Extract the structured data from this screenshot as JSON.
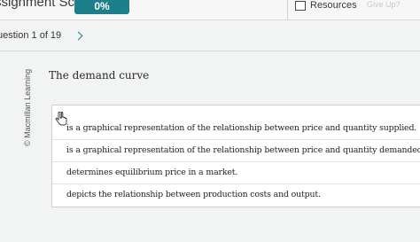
{
  "header": {
    "score_label": "ssignment Score:",
    "score_value": "0%",
    "resources_label": "Resources",
    "give_up_label": "Give Up?"
  },
  "question_nav": {
    "label": "uestion 1 of 19"
  },
  "copyright": "© Macmillan Learning",
  "question": {
    "prompt": "The demand curve",
    "options": [
      "is a graphical representation of the relationship between price and quantity supplied.",
      "is a graphical representation of the relationship between price and quantity demanded.",
      "determines equilibrium price in a market.",
      "depicts the relationship between production costs and output."
    ]
  },
  "colors": {
    "accent": "#1d7f8c",
    "background": "#f2f3f3"
  },
  "icons": [
    "checkbox-icon",
    "chevron-right-icon",
    "hand-cursor-icon"
  ]
}
